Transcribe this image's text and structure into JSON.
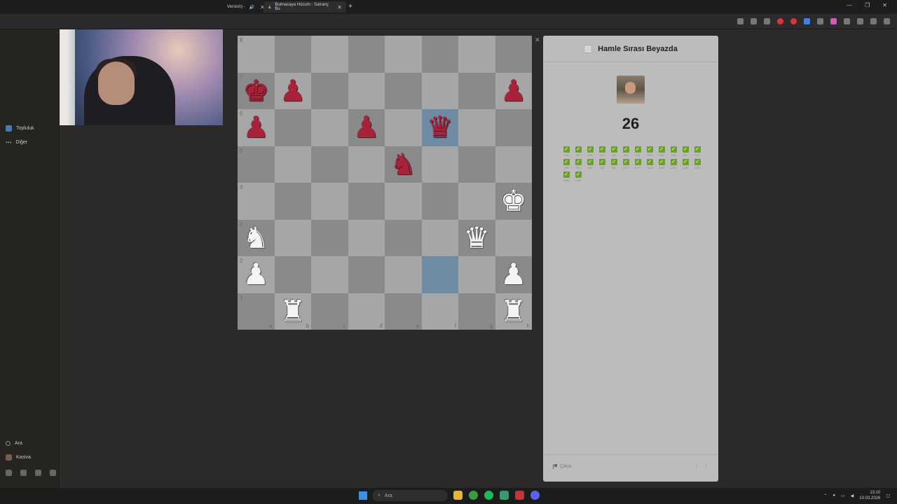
{
  "browser": {
    "tabs": [
      {
        "label": "Version) -",
        "muted": true
      },
      {
        "label": "Bulmacaya Hücum - Satranç Bu",
        "active": true
      }
    ],
    "new_tab_symbol": "+"
  },
  "sidebar": {
    "items": [
      {
        "label": "Topluluk",
        "icon": "community-icon"
      },
      {
        "label": "Diğer",
        "icon": "more-icon"
      }
    ],
    "bottom_items": [
      {
        "label": "Ara",
        "icon": "search-icon"
      },
      {
        "label": "Kasiva",
        "icon": "avatar-icon"
      }
    ]
  },
  "board": {
    "ranks": [
      "8",
      "7",
      "6",
      "5",
      "4",
      "3",
      "2",
      "1"
    ],
    "files": [
      "a",
      "b",
      "c",
      "d",
      "e",
      "f",
      "g",
      "h"
    ],
    "position": [
      [
        "",
        "",
        "",
        "",
        "",
        "",
        "",
        ""
      ],
      [
        "bK",
        "bP",
        "",
        "",
        "",
        "",
        "",
        "bP"
      ],
      [
        "bP",
        "",
        "",
        "bP",
        "",
        "bQ",
        "",
        ""
      ],
      [
        "",
        "",
        "",
        "",
        "bN",
        "",
        "",
        ""
      ],
      [
        "",
        "",
        "",
        "",
        "",
        "",
        "",
        "wK"
      ],
      [
        "wN",
        "",
        "",
        "",
        "",
        "",
        "wQ",
        ""
      ],
      [
        "wP",
        "",
        "",
        "",
        "",
        "",
        "",
        "wP"
      ],
      [
        "",
        "wR",
        "",
        "",
        "",
        "",
        "",
        "wR"
      ]
    ],
    "highlighted_squares": [
      "f6",
      "f2"
    ]
  },
  "panel": {
    "title": "Hamle Sırası Beyazda",
    "score": "26",
    "solved_puzzles": [
      "184",
      "207",
      "298",
      "310",
      "353",
      "413",
      "475",
      "540",
      "590",
      "619",
      "667",
      "712",
      "785",
      "831",
      "880",
      "930",
      "982",
      "1017",
      "1077",
      "1118",
      "1185",
      "1211",
      "1285",
      "1330",
      "1368",
      "1425"
    ],
    "resign_label": "Çıkın",
    "nav_prev": "‹",
    "nav_next": "›"
  },
  "taskbar": {
    "search_placeholder": "Ara",
    "time": "13:10",
    "date": "10.03.2026"
  },
  "colors": {
    "panel_bg": "#bcbcbc",
    "check_green": "#6ba02c",
    "black_piece": "#a8223a"
  }
}
